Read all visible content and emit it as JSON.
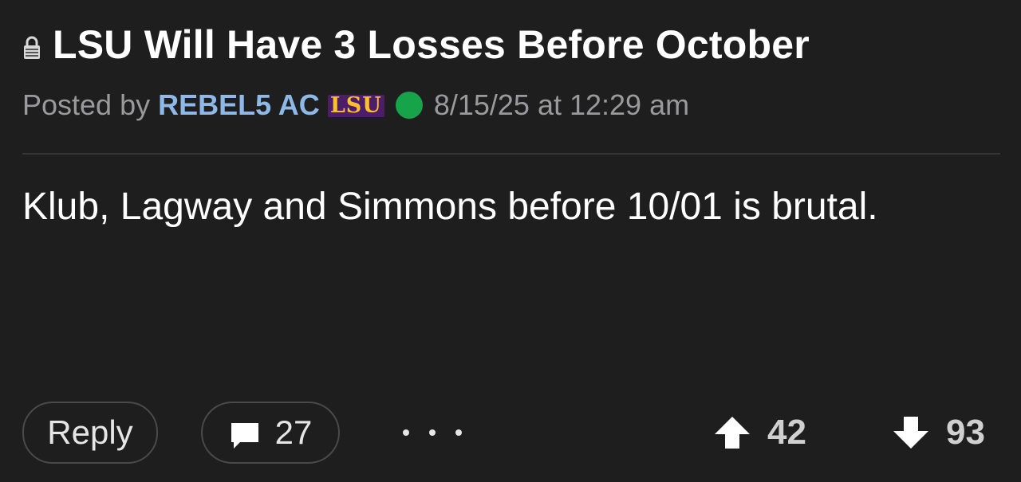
{
  "post": {
    "title": "LSU Will Have 3 Losses Before October",
    "lock_icon": "lock-icon",
    "meta": {
      "posted_by_label": "Posted by",
      "username": "REBEL5 AC",
      "team_logo_text": "LSU",
      "online_status": "online",
      "timestamp": "8/15/25 at 12:29 am"
    },
    "body": "Klub, Lagway and Simmons before 10/01 is brutal."
  },
  "actions": {
    "reply_label": "Reply",
    "comment_icon": "comment-icon",
    "comment_count": "27",
    "more_icon": "more-icon",
    "upvote_icon": "arrow-up-icon",
    "upvote_count": "42",
    "downvote_icon": "arrow-down-icon",
    "downvote_count": "93"
  },
  "colors": {
    "background": "#1e1e1f",
    "username": "#8db8e8",
    "meta_text": "#9a9a9c",
    "online": "#16a34a",
    "team_gold": "#ffc02e",
    "team_purple": "#4c1d6a"
  }
}
